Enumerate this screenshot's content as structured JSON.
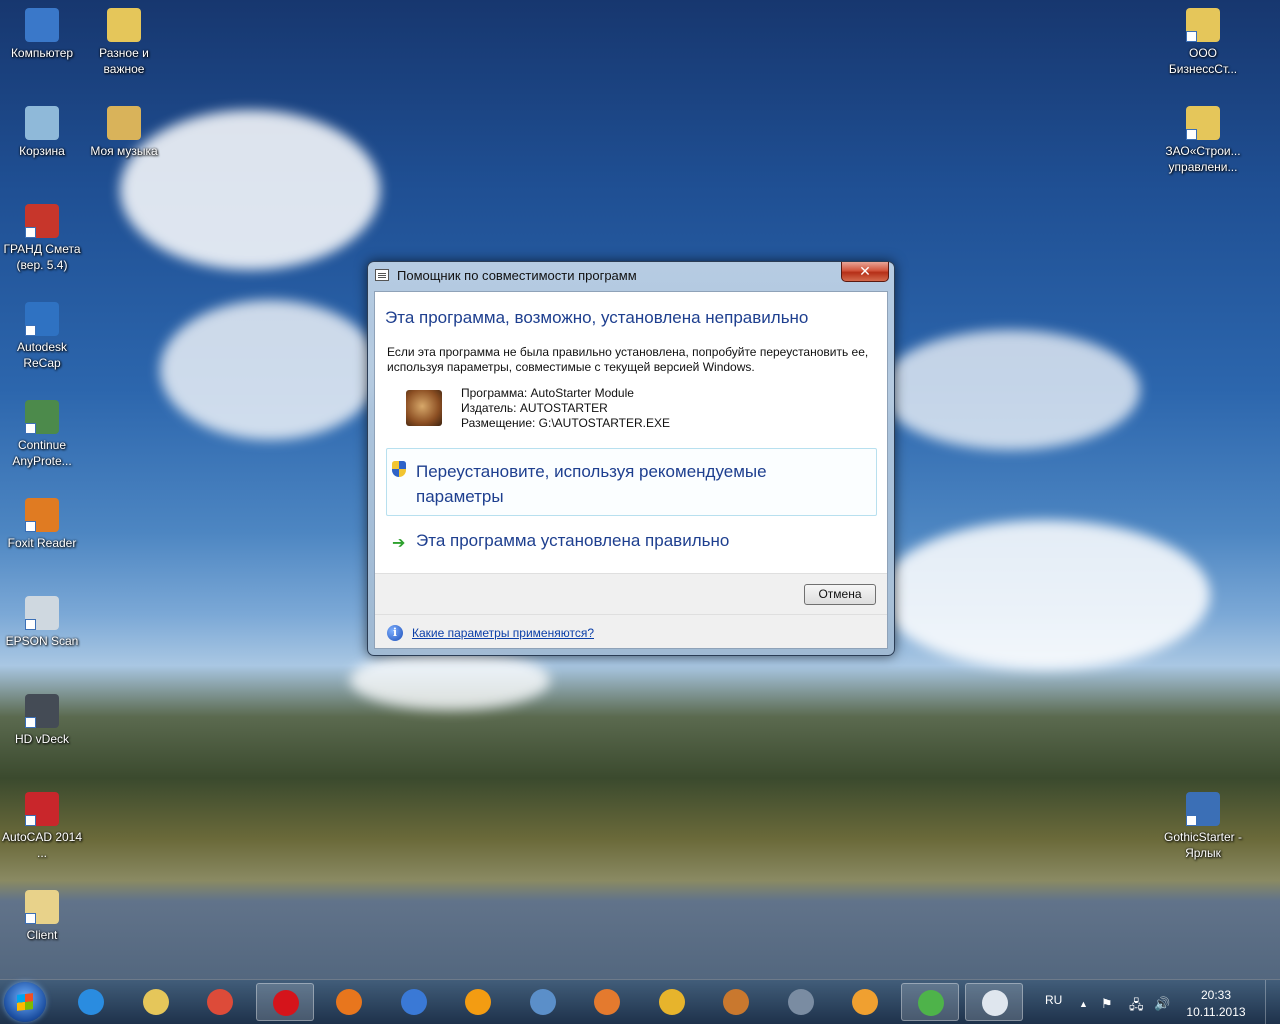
{
  "desktop": {
    "left_icons": [
      {
        "label": "Компьютер",
        "icon": "computer-icon",
        "color": "#3a78c9"
      },
      {
        "label": "Разное и важное",
        "icon": "folder-icon",
        "color": "#e5c65a"
      },
      {
        "label": "Корзина",
        "icon": "recycle-bin-icon",
        "color": "#8fb9d9"
      },
      {
        "label": "Моя музыка",
        "icon": "music-folder-icon",
        "color": "#d9b35a"
      },
      {
        "label": "ГРАНД Смета (вер. 5.4)",
        "icon": "grand-smeta-icon",
        "color": "#c7362b"
      },
      {
        "label": "Autodesk ReCap",
        "icon": "autodesk-recap-icon",
        "color": "#2f72c2"
      },
      {
        "label": "Continue AnyProte...",
        "icon": "anyprotect-icon",
        "color": "#4c8a4b"
      },
      {
        "label": "Foxit Reader",
        "icon": "foxit-reader-icon",
        "color": "#e07b22"
      },
      {
        "label": "EPSON Scan",
        "icon": "epson-scan-icon",
        "color": "#cfd8e0"
      },
      {
        "label": "HD vDeck",
        "icon": "hd-vdeck-icon",
        "color": "#444b55"
      },
      {
        "label": "AutoCAD 2014 ...",
        "icon": "autocad-icon",
        "color": "#c9262b"
      },
      {
        "label": "Client",
        "icon": "file-icon",
        "color": "#e8d28a"
      }
    ],
    "right_icons": [
      {
        "label": "ООО БизнессСт...",
        "icon": "folder-icon",
        "color": "#e5c65a"
      },
      {
        "label": "ЗАО«Строи... управлени...",
        "icon": "folder-icon",
        "color": "#e5c65a"
      },
      {
        "label": "GothicStarter - Ярлык",
        "icon": "gothic-starter-icon",
        "color": "#3b6fb6"
      }
    ]
  },
  "dialog": {
    "title": "Помощник по совместимости программ",
    "close_label": "✕",
    "heading": "Эта программа, возможно, установлена неправильно",
    "description": "Если эта программа не была правильно установлена, попробуйте переустановить ее, используя параметры, совместимые с текущей версией Windows.",
    "program_line": "Программа: AutoStarter Module",
    "publisher_line": "Издатель: AUTOSTARTER",
    "location_line": "Размещение: G:\\AUTOSTARTER.EXE",
    "option_reinstall": "Переустановите, используя рекомендуемые параметры",
    "option_correct": "Эта программа установлена правильно",
    "cancel_label": "Отмена",
    "help_link": "Какие параметры применяются?"
  },
  "taskbar": {
    "apps": [
      {
        "name": "ie",
        "icon": "internet-explorer-icon",
        "color": "#2a8ce0",
        "active": false
      },
      {
        "name": "explorer",
        "icon": "file-explorer-icon",
        "color": "#e5c65a",
        "active": false
      },
      {
        "name": "chrome",
        "icon": "chrome-icon",
        "color": "#dd4b39",
        "active": false
      },
      {
        "name": "opera",
        "icon": "opera-icon",
        "color": "#d5141b",
        "active": true
      },
      {
        "name": "firefox",
        "icon": "firefox-icon",
        "color": "#e8761d",
        "active": false
      },
      {
        "name": "app-lightning",
        "icon": "lightning-icon",
        "color": "#3a79d6",
        "active": false
      },
      {
        "name": "aimp",
        "icon": "aimp-icon",
        "color": "#f39c12",
        "active": false
      },
      {
        "name": "media",
        "icon": "media-icon",
        "color": "#5b8fc9",
        "active": false
      },
      {
        "name": "xnview",
        "icon": "eye-icon",
        "color": "#e47a2e",
        "active": false
      },
      {
        "name": "app-eye",
        "icon": "eye2-icon",
        "color": "#e7b42c",
        "active": false
      },
      {
        "name": "installer",
        "icon": "package-icon",
        "color": "#c9782e",
        "active": false
      },
      {
        "name": "editor",
        "icon": "document-edit-icon",
        "color": "#7a8ca2",
        "active": false
      },
      {
        "name": "player",
        "icon": "video-player-icon",
        "color": "#f0a030",
        "active": false
      },
      {
        "name": "utorrent",
        "icon": "utorrent-icon",
        "color": "#4eb34a",
        "active": true
      },
      {
        "name": "compat-assistant",
        "icon": "dialog-list-icon",
        "color": "#dfe6ee",
        "active": true
      }
    ],
    "language": "RU",
    "time": "20:33",
    "date": "10.11.2013"
  }
}
